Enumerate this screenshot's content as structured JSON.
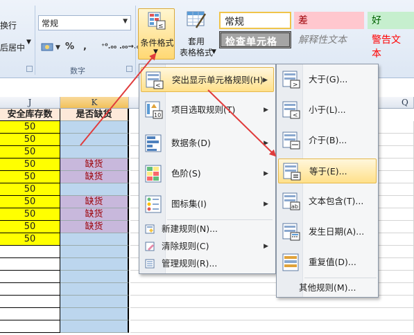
{
  "ribbon": {
    "row1_partial": "换行",
    "row2_partial": "后居中",
    "number_format": "常规",
    "number_buttons": [
      "%",
      ",",
      "⁺⁰.₀₀",
      ".₀₀→.₀"
    ],
    "currency_symbol": "$",
    "number_group_label": "数字",
    "conditional_format_label": "条件格式",
    "table_format_line1": "套用",
    "table_format_line2": "表格格式",
    "styles": {
      "normal": "常规",
      "bad": "差",
      "good": "好",
      "check_cell": "检查单元格",
      "explanatory": "解释性文本",
      "warning": "警告文本"
    }
  },
  "sheet": {
    "col_headers": [
      "J",
      "K",
      "Q"
    ],
    "header_row": {
      "j": "安全库存数",
      "k": "是否缺货"
    },
    "rows": [
      {
        "j": "50",
        "k": ""
      },
      {
        "j": "50",
        "k": ""
      },
      {
        "j": "50",
        "k": ""
      },
      {
        "j": "50",
        "k": "缺货"
      },
      {
        "j": "50",
        "k": "缺货"
      },
      {
        "j": "50",
        "k": ""
      },
      {
        "j": "50",
        "k": "缺货"
      },
      {
        "j": "50",
        "k": "缺货"
      },
      {
        "j": "50",
        "k": "缺货"
      },
      {
        "j": "50",
        "k": ""
      },
      {
        "j": "",
        "k": ""
      },
      {
        "j": "",
        "k": ""
      },
      {
        "j": "",
        "k": ""
      },
      {
        "j": "",
        "k": ""
      },
      {
        "j": "",
        "k": ""
      },
      {
        "j": "",
        "k": ""
      },
      {
        "j": "",
        "k": ""
      }
    ]
  },
  "cf_menu": {
    "items": [
      {
        "label": "突出显示单元格规则(H)",
        "icon": "highlight-rules-icon"
      },
      {
        "label": "项目选取规则(T)",
        "icon": "top-bottom-rules-icon"
      },
      {
        "label": "数据条(D)",
        "icon": "data-bars-icon"
      },
      {
        "label": "色阶(S)",
        "icon": "color-scales-icon"
      },
      {
        "label": "图标集(I)",
        "icon": "icon-sets-icon"
      }
    ],
    "small_items": [
      {
        "label": "新建规则(N)...",
        "icon": "new-rule-icon"
      },
      {
        "label": "清除规则(C)",
        "icon": "clear-rules-icon"
      },
      {
        "label": "管理规则(R)...",
        "icon": "manage-rules-icon"
      }
    ]
  },
  "highlight_submenu": {
    "items": [
      {
        "label": "大于(G)...",
        "icon": "greater-than-icon"
      },
      {
        "label": "小于(L)...",
        "icon": "less-than-icon"
      },
      {
        "label": "介于(B)...",
        "icon": "between-icon"
      },
      {
        "label": "等于(E)...",
        "icon": "equal-to-icon"
      },
      {
        "label": "文本包含(T)...",
        "icon": "text-contains-icon"
      },
      {
        "label": "发生日期(A)...",
        "icon": "date-occurring-icon"
      },
      {
        "label": "重复值(D)...",
        "icon": "duplicate-values-icon"
      }
    ],
    "more_rules": "其他规则(M)..."
  },
  "colors": {
    "accent_red": "#e03c3c",
    "highlight": "#ffe08a",
    "yellow_fill": "#ffff00",
    "blue_fill": "#bcd6ee",
    "shortage_fill": "#c8b8dc",
    "shortage_text": "#9c0006"
  }
}
